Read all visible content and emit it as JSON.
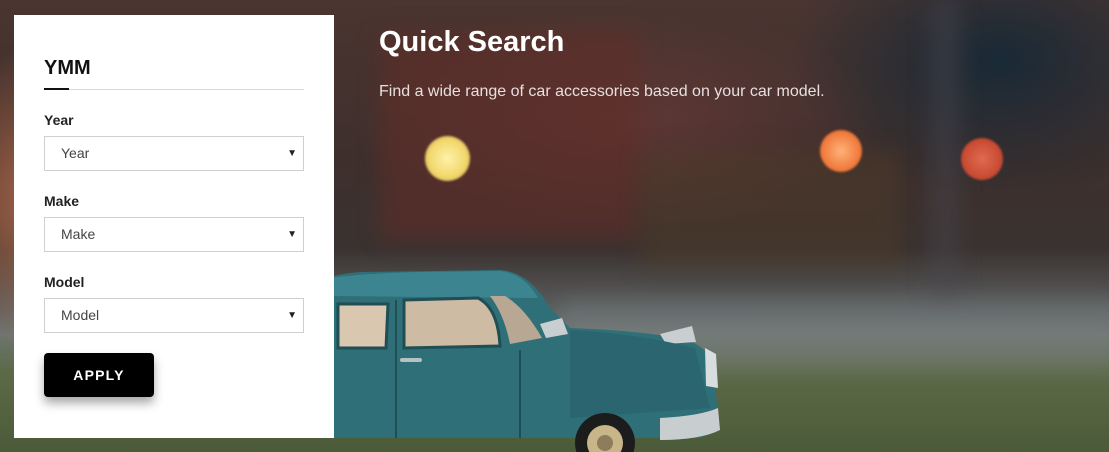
{
  "panel": {
    "title": "YMM",
    "fields": [
      {
        "label": "Year",
        "value": "Year"
      },
      {
        "label": "Make",
        "value": "Make"
      },
      {
        "label": "Model",
        "value": "Model"
      }
    ],
    "apply_label": "APPLY"
  },
  "hero": {
    "title": "Quick Search",
    "description": "Find a wide range of car accessories based on your car model."
  },
  "icons": {
    "select_caret": "caret-down-icon"
  },
  "colors": {
    "apply_button": "#000000",
    "panel_bg": "#ffffff",
    "car_body": "#2f6f78"
  }
}
